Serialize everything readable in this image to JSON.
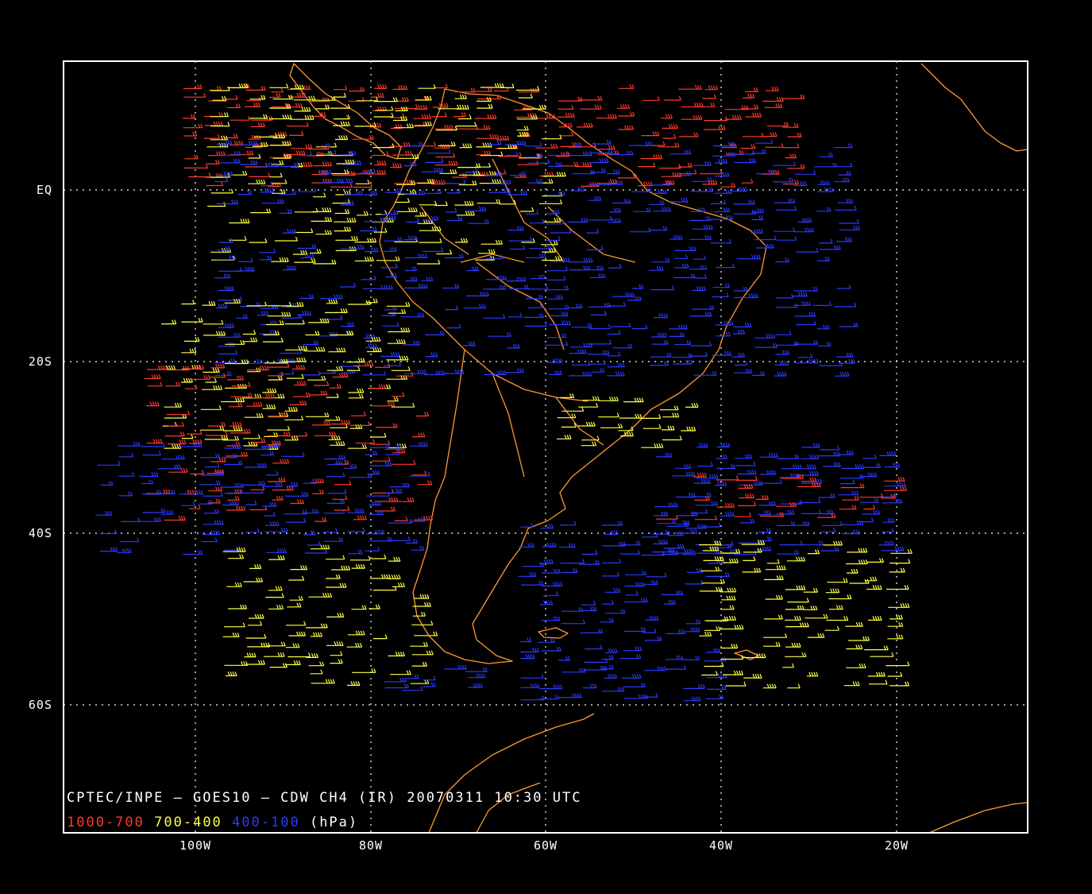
{
  "map": {
    "caption": "CPTEC/INPE — GOES10 — CDW CH4 (IR) 20070311 10:30 UTC",
    "lat_labels": [
      "EQ",
      "20S",
      "40S",
      "60S"
    ],
    "lon_labels": [
      "100W",
      "80W",
      "60W",
      "40W",
      "20W"
    ],
    "legend": [
      {
        "text": "1000-700",
        "color": "#ff3a2a"
      },
      {
        "text": "700-400",
        "color": "#ffff40"
      },
      {
        "text": "400-100",
        "color": "#2a3aff"
      }
    ],
    "legend_unit": "(hPa)",
    "colors": {
      "background": "#000000",
      "frame": "#ffffff",
      "coastline": "#ff9933",
      "grid": "#ffffff",
      "low_level": "#ff3a2a",
      "mid_level": "#ffff40",
      "high_level": "#2a3aff"
    }
  }
}
